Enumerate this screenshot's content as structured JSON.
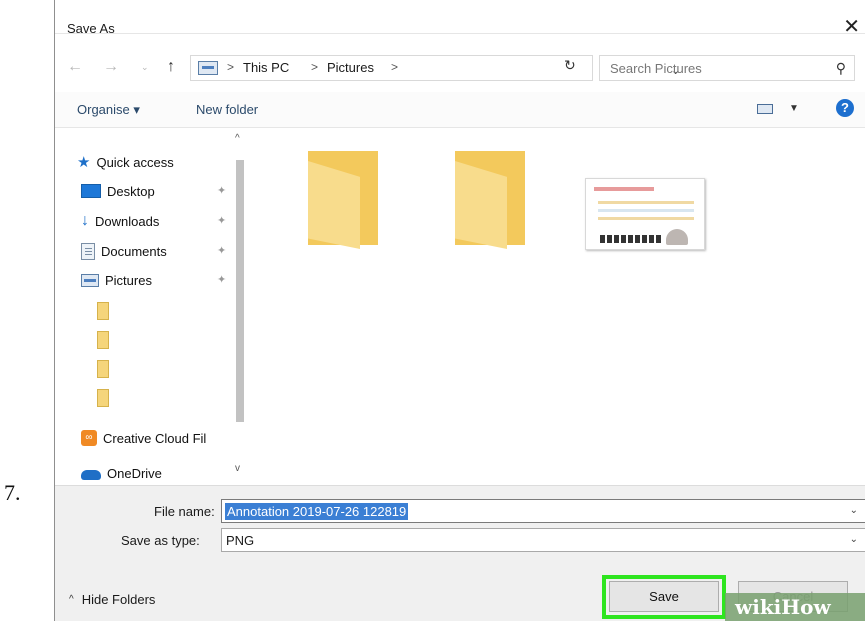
{
  "step_number": "7.",
  "dialog": {
    "title": "Save As",
    "close_icon": "close-icon"
  },
  "address": {
    "back_icon": "←",
    "forward_icon": "→",
    "up_icon": "↑",
    "crumbs": [
      "This PC",
      "Pictures"
    ],
    "separator": ">",
    "refresh_icon": "↻",
    "dropdown_icon": "⌄"
  },
  "search": {
    "placeholder": "Search Pictures",
    "icon": "⚲"
  },
  "toolbar": {
    "organise_label": "Organise ▾",
    "new_folder_label": "New folder",
    "view_dropdown": "▼",
    "help_label": "?"
  },
  "nav": {
    "quick_access": "Quick access",
    "items": [
      "Desktop",
      "Downloads",
      "Documents",
      "Pictures"
    ],
    "creative_cloud": "Creative Cloud Fil",
    "onedrive": "OneDrive",
    "pin_icon": "✦",
    "scroll_up": "^",
    "scroll_down": "v"
  },
  "form": {
    "file_name_label": "File name:",
    "file_name_value": "Annotation 2019-07-26 122819",
    "save_type_label": "Save as type:",
    "save_type_value": "PNG",
    "dropdown_chevron": "⌄"
  },
  "footer": {
    "hide_folders_label": "Hide Folders",
    "hide_caret": "^",
    "save_label": "Save",
    "cancel_label": "Cancel"
  },
  "watermark": "wikiHow",
  "colors": {
    "highlight": "#2ee51f",
    "selection": "#3b7fd4",
    "folder": "#f3c95c",
    "accent": "#1e70c9"
  }
}
